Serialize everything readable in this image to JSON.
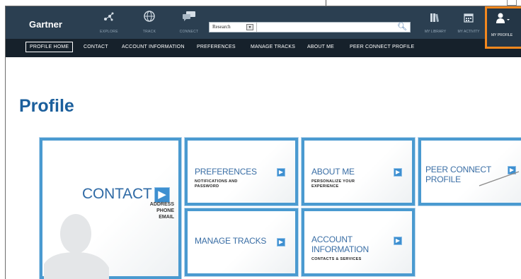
{
  "header": {
    "logo": "Gartner",
    "nav": [
      {
        "label": "EXPLORE",
        "icon": "explore-icon"
      },
      {
        "label": "TRACK",
        "icon": "globe-icon"
      },
      {
        "label": "CONNECT",
        "icon": "chat-icon"
      }
    ],
    "search": {
      "category": "Research",
      "value": ""
    },
    "right": [
      {
        "label": "MY LIBRARY",
        "icon": "library-icon"
      },
      {
        "label": "MY ACTIVITY",
        "icon": "calendar-icon"
      }
    ],
    "profile_label": "MY PROFILE"
  },
  "subnav": [
    "PROFILE HOME",
    "CONTACT",
    "ACCOUNT INFORMATION",
    "PREFERENCES",
    "MANAGE TRACKS",
    "ABOUT ME",
    "PEER CONNECT PROFILE"
  ],
  "page_title": "Profile",
  "tiles": {
    "contact": {
      "title": "CONTACT",
      "lines": [
        "ADDRESS",
        "PHONE",
        "EMAIL"
      ]
    },
    "preferences": {
      "title": "PREFERENCES",
      "sub": [
        "NOTIFICATIONS AND",
        "PASSWORD"
      ]
    },
    "about_me": {
      "title": "ABOUT ME",
      "sub": [
        "PERSONALIZE YOUR",
        "EXPERIENCE"
      ]
    },
    "peer_connect": {
      "title1": "PEER CONNECT",
      "title2": "PROFILE"
    },
    "manage_tracks": {
      "title": "MANAGE TRACKS"
    },
    "account": {
      "title1": "ACCOUNT",
      "title2": "INFORMATION",
      "sub": "CONTACTS & SERVICES"
    }
  },
  "colors": {
    "topbar": "#2b3f51",
    "subnav": "#16212b",
    "accent": "#4a9ad0",
    "highlight": "#f4881e",
    "title": "#1b5f9c"
  }
}
